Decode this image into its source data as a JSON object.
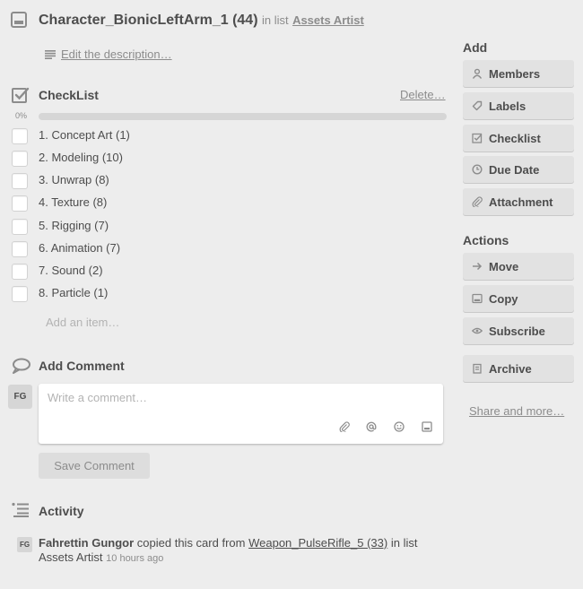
{
  "header": {
    "title": "Character_BionicLeftArm_1 (44)",
    "in_list_text": "in list",
    "list_name": "Assets Artist",
    "edit_description": "Edit the description…"
  },
  "checklist": {
    "title": "CheckList",
    "delete_label": "Delete…",
    "progress_label": "0%",
    "progress_fraction": 0,
    "items": [
      {
        "label": "1. Concept Art (1)",
        "checked": false
      },
      {
        "label": "2. Modeling (10)",
        "checked": false
      },
      {
        "label": "3. Unwrap (8)",
        "checked": false
      },
      {
        "label": "4. Texture (8)",
        "checked": false
      },
      {
        "label": "5. Rigging (7)",
        "checked": false
      },
      {
        "label": "6. Animation (7)",
        "checked": false
      },
      {
        "label": "7. Sound (2)",
        "checked": false
      },
      {
        "label": "8. Particle (1)",
        "checked": false
      }
    ],
    "add_item_placeholder": "Add an item…"
  },
  "comment": {
    "title": "Add Comment",
    "avatar_initials": "FG",
    "placeholder": "Write a comment…",
    "save_label": "Save Comment"
  },
  "activity": {
    "title": "Activity",
    "entry": {
      "avatar_initials": "FG",
      "user": "Fahrettin Gungor",
      "action": "copied this card from",
      "source_card": "Weapon_PulseRifle_5 (33)",
      "in_list_text": "in list",
      "list_name": "Assets Artist",
      "time": "10 hours ago"
    }
  },
  "sidebar": {
    "add_heading": "Add",
    "add_buttons": [
      {
        "label": "Members",
        "icon": "person-icon"
      },
      {
        "label": "Labels",
        "icon": "tag-icon"
      },
      {
        "label": "Checklist",
        "icon": "checkbox-icon"
      },
      {
        "label": "Due Date",
        "icon": "clock-icon"
      },
      {
        "label": "Attachment",
        "icon": "paperclip-icon"
      }
    ],
    "actions_heading": "Actions",
    "action_buttons": [
      {
        "label": "Move",
        "icon": "arrow-right-icon"
      },
      {
        "label": "Copy",
        "icon": "card-icon"
      },
      {
        "label": "Subscribe",
        "icon": "eye-icon"
      },
      {
        "label": "Archive",
        "icon": "archive-icon"
      }
    ],
    "share_label": "Share and more…"
  },
  "colors": {
    "background": "#ededed",
    "text": "#4d4d4d",
    "muted": "#8c8c8c",
    "button": "#e2e2e2"
  }
}
